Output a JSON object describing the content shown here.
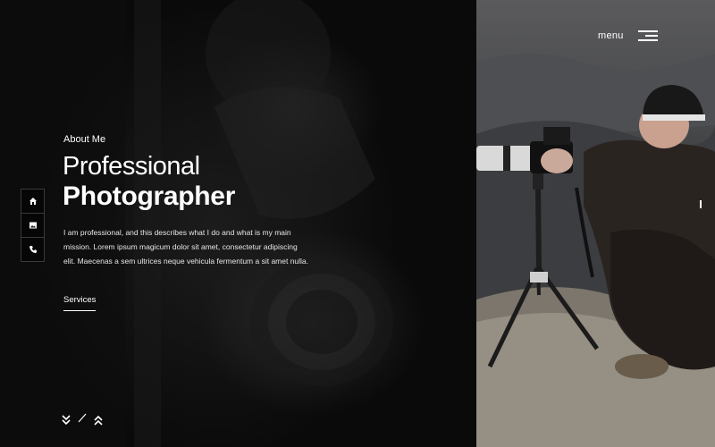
{
  "header": {
    "menu_label": "menu",
    "menu_icon": "hamburger-icon"
  },
  "side_nav": {
    "items": [
      {
        "icon": "home-icon"
      },
      {
        "icon": "image-icon"
      },
      {
        "icon": "phone-icon"
      }
    ]
  },
  "hero": {
    "eyebrow": "About Me",
    "title_line1": "Professional",
    "title_line2": "Photographer",
    "description": "I am professional, and this describes what I do and what is my main mission. Lorem ipsum magicum dolor sit amet, consectetur adipiscing elit. Maecenas a sem ultrices neque vehicula fermentum a sit amet nulla.",
    "cta_label": "Services"
  },
  "pager": {
    "prev_icon": "chevrons-down-icon",
    "next_icon": "chevrons-up-icon"
  },
  "colors": {
    "background": "#0b0b0b",
    "text": "#ffffff",
    "border": "#3a3a3a"
  }
}
